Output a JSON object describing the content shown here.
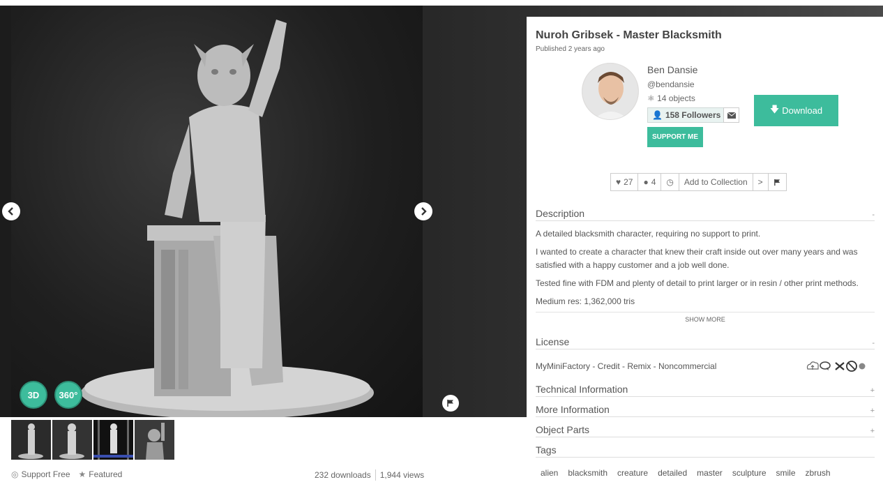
{
  "gallery": {
    "badge_3d": "3D",
    "badge_360": "360°",
    "support_free": "Support Free",
    "featured": "Featured",
    "downloads": "232 downloads",
    "views": "1,944 views",
    "thumbnail_count": 4
  },
  "object": {
    "title": "Nuroh Gribsek - Master Blacksmith",
    "published": "Published 2 years ago"
  },
  "author": {
    "name": "Ben Dansie",
    "handle": "@bendansie",
    "objects": "14 objects",
    "followers": "158 Followers",
    "support_label": "SUPPORT ME"
  },
  "download_label": "Download",
  "actions": {
    "likes": "27",
    "comments": "4",
    "add_to_collection": "Add to Collection"
  },
  "description": {
    "heading": "Description",
    "toggle": "-",
    "paragraphs": [
      "A detailed blacksmith character, requiring no support to print.",
      "I wanted to create a character that knew their craft inside out over many years and was satisfied with a happy customer and a job well done.",
      "Tested fine with FDM and plenty of detail to print larger or in resin / other print methods.",
      "Medium res: 1,362,000 tris"
    ],
    "show_more": "SHOW MORE"
  },
  "license": {
    "heading": "License",
    "toggle": "-",
    "text": "MyMiniFactory - Credit - Remix - Noncommercial"
  },
  "sections": {
    "technical": {
      "heading": "Technical Information",
      "toggle": "+"
    },
    "more": {
      "heading": "More Information",
      "toggle": "+"
    },
    "parts": {
      "heading": "Object Parts",
      "toggle": "+"
    },
    "tags": {
      "heading": "Tags"
    }
  },
  "tags": [
    "alien",
    "blacksmith",
    "creature",
    "detailed",
    "master",
    "sculpture",
    "smile",
    "zbrush"
  ],
  "colors": {
    "accent": "#3dbc9c",
    "text": "#555555"
  }
}
